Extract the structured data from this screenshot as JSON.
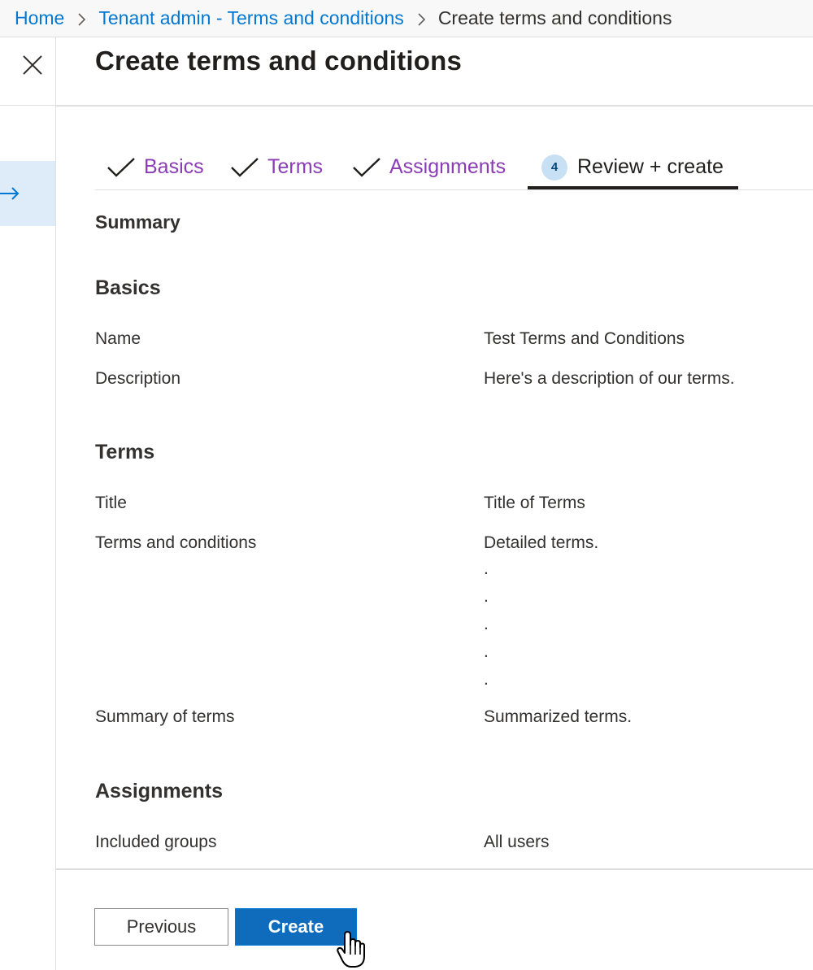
{
  "breadcrumb": {
    "items": [
      "Home",
      "Tenant admin - Terms and conditions"
    ],
    "current": "Create terms and conditions"
  },
  "header": {
    "title": "Create terms and conditions"
  },
  "tabs": [
    {
      "label": "Basics",
      "state": "done"
    },
    {
      "label": "Terms",
      "state": "done"
    },
    {
      "label": "Assignments",
      "state": "done"
    },
    {
      "label": "Review + create",
      "state": "active",
      "step": "4"
    }
  ],
  "summary": {
    "heading": "Summary",
    "basics": {
      "heading": "Basics",
      "name_label": "Name",
      "name_value": "Test Terms and Conditions",
      "description_label": "Description",
      "description_value": "Here's a description of our terms."
    },
    "terms": {
      "heading": "Terms",
      "title_label": "Title",
      "title_value": "Title of Terms",
      "tc_label": "Terms and conditions",
      "tc_value": "Detailed terms.",
      "tc_dots": [
        ".",
        ".",
        ".",
        ".",
        "."
      ],
      "summary_label": "Summary of terms",
      "summary_value": "Summarized terms."
    },
    "assignments": {
      "heading": "Assignments",
      "groups_label": "Included groups",
      "groups_value": "All users"
    }
  },
  "footer": {
    "previous_label": "Previous",
    "create_label": "Create"
  },
  "colors": {
    "link": "#0078d4",
    "completed_tab": "#8a3bb5",
    "primary_button": "#0f6cbd",
    "active_rail": "#deecf9"
  },
  "icons": {
    "breadcrumb_separator": "chevron-right-icon",
    "close": "close-icon",
    "rail_active": "arrow-right-icon",
    "tab_done": "checkmark-icon",
    "cursor": "hand-pointer-icon"
  }
}
